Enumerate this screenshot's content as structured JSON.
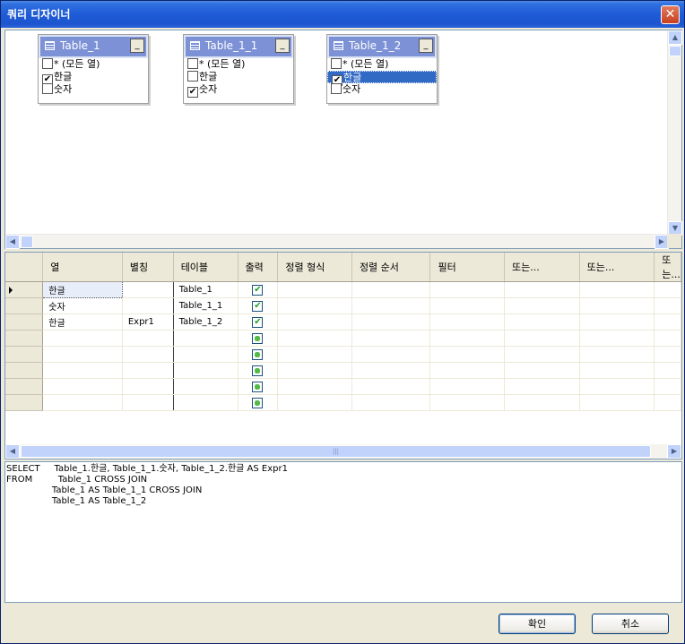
{
  "window": {
    "title": "쿼리 디자이너",
    "close_glyph": "✕"
  },
  "diagram": {
    "tables": [
      {
        "name": "Table_1",
        "columns": [
          {
            "label": "* (모든 열)",
            "checked": false,
            "selected": false
          },
          {
            "label": "한글",
            "checked": true,
            "selected": false
          },
          {
            "label": "숫자",
            "checked": false,
            "selected": false
          }
        ]
      },
      {
        "name": "Table_1_1",
        "columns": [
          {
            "label": "* (모든 열)",
            "checked": false,
            "selected": false
          },
          {
            "label": "한글",
            "checked": false,
            "selected": false
          },
          {
            "label": "숫자",
            "checked": true,
            "selected": false
          }
        ]
      },
      {
        "name": "Table_1_2",
        "columns": [
          {
            "label": "* (모든 열)",
            "checked": false,
            "selected": false
          },
          {
            "label": "한글",
            "checked": true,
            "selected": true
          },
          {
            "label": "숫자",
            "checked": false,
            "selected": false
          }
        ]
      }
    ]
  },
  "grid": {
    "headers": [
      "열",
      "별칭",
      "테이블",
      "출력",
      "정렬 형식",
      "정렬 순서",
      "필터",
      "또는...",
      "또는...",
      "또는..."
    ],
    "rows": [
      {
        "column": "한글",
        "alias": "",
        "table": "Table_1",
        "output": true
      },
      {
        "column": "숫자",
        "alias": "",
        "table": "Table_1_1",
        "output": true
      },
      {
        "column": "한글",
        "alias": "Expr1",
        "table": "Table_1_2",
        "output": true
      },
      {
        "column": "",
        "alias": "",
        "table": "",
        "output": false
      },
      {
        "column": "",
        "alias": "",
        "table": "",
        "output": false
      },
      {
        "column": "",
        "alias": "",
        "table": "",
        "output": false
      },
      {
        "column": "",
        "alias": "",
        "table": "",
        "output": false
      },
      {
        "column": "",
        "alias": "",
        "table": "",
        "output": false
      }
    ],
    "scroll_grip": "|||"
  },
  "sql": {
    "lines": [
      "SELECT     Table_1.한글, Table_1_1.숫자, Table_1_2.한글 AS Expr1",
      "FROM         Table_1 CROSS JOIN",
      "                Table_1 AS Table_1_1 CROSS JOIN",
      "                Table_1 AS Table_1_2"
    ]
  },
  "buttons": {
    "ok": "확인",
    "cancel": "취소"
  },
  "glyphs": {
    "check": "✔",
    "up": "▲",
    "down": "▼",
    "left": "◀",
    "right": "▶",
    "minimize": "_"
  }
}
